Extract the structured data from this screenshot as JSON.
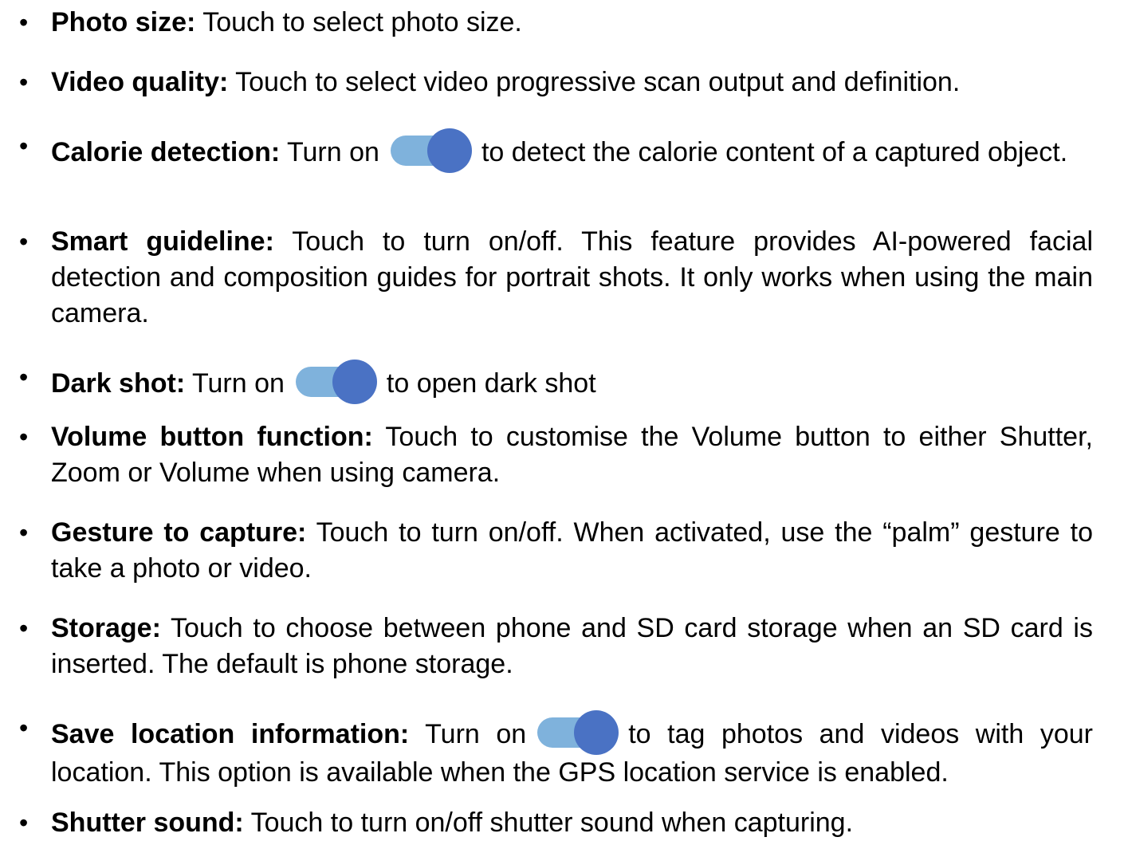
{
  "items": [
    {
      "label": "Photo size:",
      "text": "Touch to select photo size."
    },
    {
      "label": "Video quality:",
      "text": "Touch to select video progressive scan output and definition."
    },
    {
      "label": "Calorie detection:",
      "before": "Turn on",
      "after": "to detect the calorie content of a captured object."
    },
    {
      "label": "Smart guideline:",
      "text": "Touch to turn on/off. This feature provides AI-powered facial detection and composition guides for portrait shots. It only works when using the main camera."
    },
    {
      "label": "Dark shot:",
      "before": "Turn on",
      "after": "to open dark shot"
    },
    {
      "label": "Volume button function:",
      "text": "Touch to customise the Volume button to either Shutter, Zoom or Volume when using camera."
    },
    {
      "label": "Gesture to capture:",
      "text": "Touch to turn on/off. When activated, use the “palm” gesture to take a photo or video."
    },
    {
      "label": "Storage:",
      "text": "Touch to choose between phone and SD card storage when an SD card is inserted. The default is phone storage."
    },
    {
      "label": "Save location information:",
      "before": "Turn on",
      "after": "to tag photos and videos with your location. This option is available when the GPS location service is enabled."
    },
    {
      "label": "Shutter sound:",
      "text": "Touch to turn on/off shutter sound when capturing."
    }
  ],
  "bullet": "•",
  "toggle": {
    "state": "on",
    "track_color": "#7fb2dc",
    "knob_color": "#4a72c4"
  }
}
